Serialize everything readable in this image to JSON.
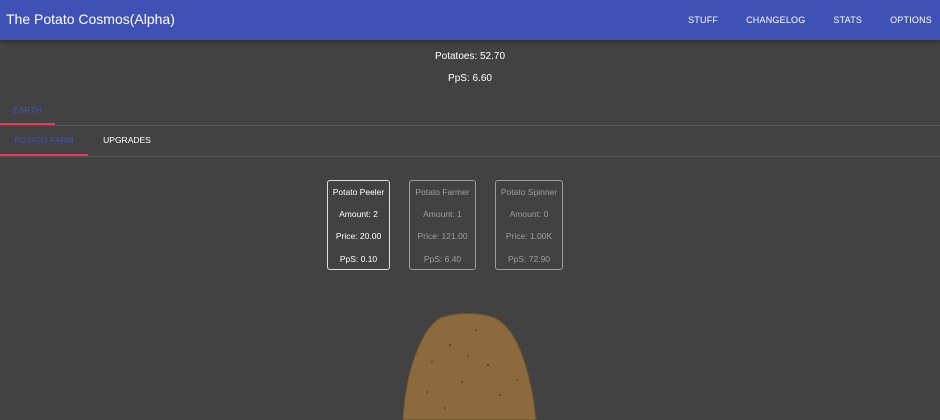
{
  "app": {
    "title": "The Potato Cosmos(Alpha)"
  },
  "nav": {
    "items": [
      "STUFF",
      "CHANGELOG",
      "STATS",
      "OPTIONS"
    ]
  },
  "stats": {
    "potatoes": "Potatoes: 52.70",
    "pps": "PpS: 6.60"
  },
  "location_tabs": [
    {
      "label": "EARTH",
      "active": true
    }
  ],
  "section_tabs": [
    {
      "label": "POTATO FARM",
      "active": true
    },
    {
      "label": "UPGRADES",
      "active": false
    }
  ],
  "buildings": [
    {
      "name": "Potato Peeler",
      "amount": "Amount: 2",
      "price": "Price: 20.00",
      "pps": "PpS: 0.10",
      "affordable": true
    },
    {
      "name": "Potato Farmer",
      "amount": "Amount: 1",
      "price": "Price: 121.00",
      "pps": "PpS: 6.40",
      "affordable": false
    },
    {
      "name": "Potato Spinner",
      "amount": "Amount: 0",
      "price": "Price: 1.00K",
      "pps": "PpS: 72.90",
      "affordable": false
    }
  ],
  "colors": {
    "appbar": "#3f51b5",
    "background": "#424242",
    "tab_active_text": "#3f51b5",
    "tab_indicator": "#e53957",
    "potato_fill": "#8b6a3e"
  },
  "icons": {
    "potato": "potato-clicker-icon"
  }
}
